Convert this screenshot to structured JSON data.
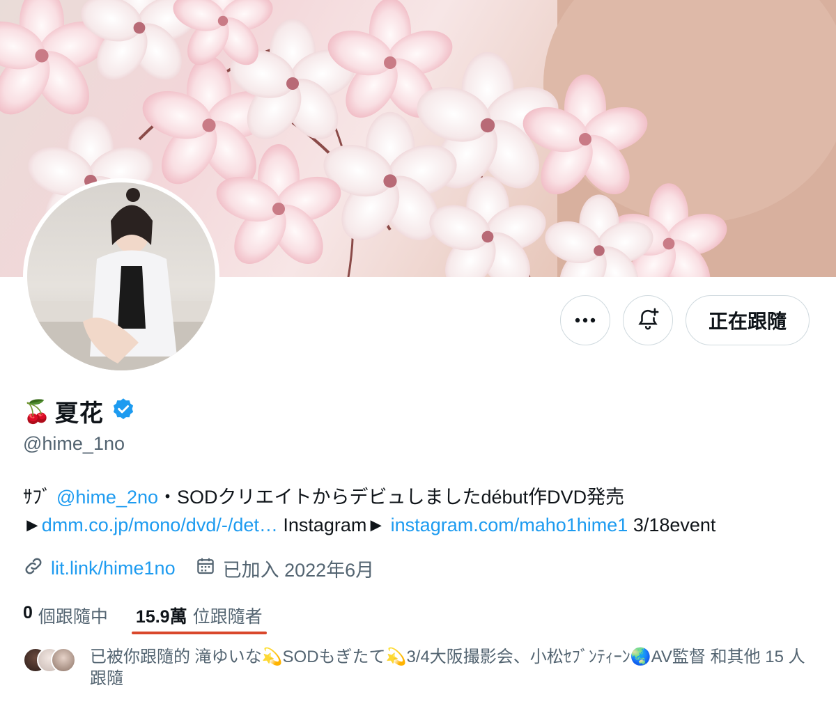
{
  "banner": {
    "description_icon": "cherry-blossom-banner"
  },
  "profile": {
    "display_name": "夏花",
    "name_emoji": "🍒",
    "handle": "@hime_1no",
    "verified": true,
    "verified_color": "#1d9bf0"
  },
  "actions": {
    "more_icon": "more-icon",
    "notify_icon": "bell-plus-icon",
    "follow_label": "正在跟隨"
  },
  "bio": {
    "line1_prefix": "ｻﾌﾞ ",
    "line1_mention": "@hime_2no",
    "line1_text": "・SODクリエイトからデビュしましたdébut作DVD発売",
    "line2_arrow": "►",
    "line2_link1": "dmm.co.jp/mono/dvd/-/det…",
    "line2_text": " Instagram► ",
    "line2_link2": "instagram.com/maho1hime1",
    "line2_suffix": " 3/18event"
  },
  "meta": {
    "link": "lit.link/hime1no",
    "joined": "已加入 2022年6月"
  },
  "stats": {
    "following_count": "0",
    "following_label": "個跟隨中",
    "followers_count": "15.9萬",
    "followers_label": "位跟隨者"
  },
  "known_followers": {
    "text": "已被你跟隨的 滝ゆいな💫SODもぎたて💫3/4大阪撮影会、小松ｾﾌﾞﾝﾃｨｰﾝ🌏AV監督 和其他 15 人跟隨"
  },
  "colors": {
    "link": "#1d9bf0",
    "secondary_text": "#536471",
    "tab_underline": "#d9472b"
  }
}
